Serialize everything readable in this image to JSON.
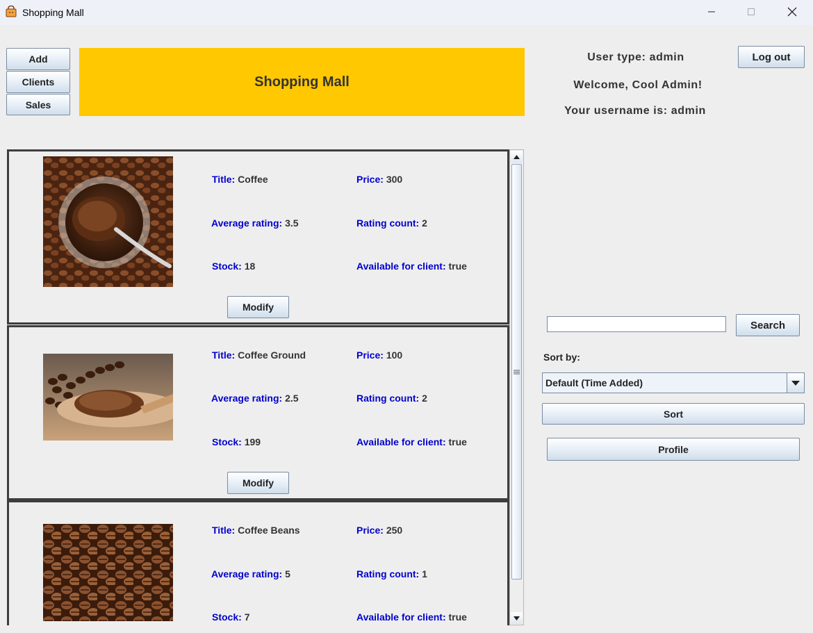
{
  "window": {
    "title": "Shopping Mall"
  },
  "nav": {
    "add": "Add",
    "clients": "Clients",
    "sales": "Sales"
  },
  "banner": {
    "text": "Shopping Mall"
  },
  "user": {
    "type_text": "User type: admin",
    "welcome_text": "Welcome, Cool Admin!",
    "username_text": "Your username is: admin",
    "logout_label": "Log out"
  },
  "labels": {
    "title": "Title:",
    "price": "Price:",
    "average_rating": "Average rating:",
    "rating_count": "Rating count:",
    "stock": "Stock:",
    "available": "Available for client:",
    "modify": "Modify"
  },
  "products": [
    {
      "title": "Coffee",
      "price": "300",
      "average_rating": "3.5",
      "rating_count": "2",
      "stock": "18",
      "available": "true",
      "image": "coffee-jar-spoon"
    },
    {
      "title": "Coffee Ground",
      "price": "100",
      "average_rating": "2.5",
      "rating_count": "2",
      "stock": "199",
      "available": "true",
      "image": "coffee-ground-spoon"
    },
    {
      "title": "Coffee Beans",
      "price": "250",
      "average_rating": "5",
      "rating_count": "1",
      "stock": "7",
      "available": "true",
      "image": "coffee-beans"
    }
  ],
  "search": {
    "value": "",
    "button_label": "Search"
  },
  "sort": {
    "label": "Sort by:",
    "selected": "Default (Time Added)",
    "button_label": "Sort"
  },
  "profile": {
    "button_label": "Profile"
  },
  "colors": {
    "banner": "#ffc800",
    "field_label": "#0000cc",
    "item_border": "#3d3d3d"
  }
}
